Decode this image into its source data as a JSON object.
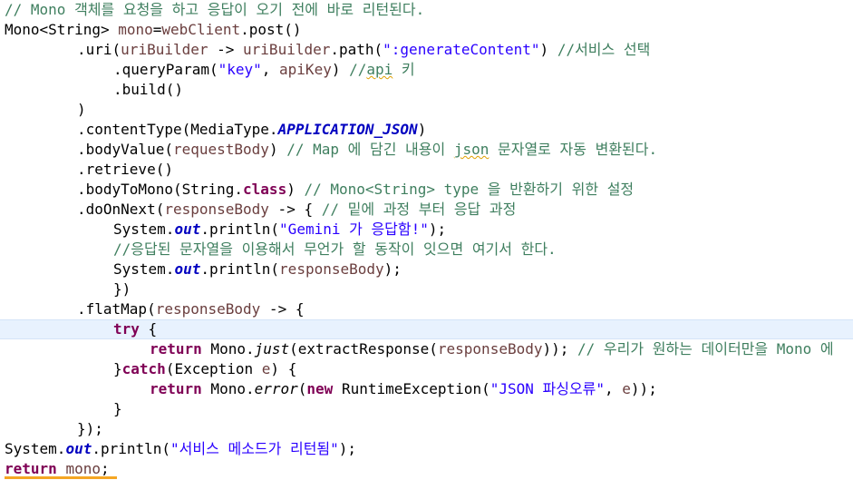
{
  "lines": [
    {
      "indent": 0,
      "tokens": [
        {
          "t": "cm",
          "v": "// Mono 객체를 요청을 하고 응답이 오기 전에 바로 리턴된다."
        }
      ]
    },
    {
      "indent": 0,
      "tokens": [
        {
          "t": "",
          "v": "Mono<String> "
        },
        {
          "t": "var",
          "v": "mono"
        },
        {
          "t": "",
          "v": "="
        },
        {
          "t": "var",
          "v": "webClient"
        },
        {
          "t": "",
          "v": ".post()"
        }
      ]
    },
    {
      "indent": 1,
      "tokens": [
        {
          "t": "",
          "v": ".uri("
        },
        {
          "t": "var",
          "v": "uriBuilder"
        },
        {
          "t": "",
          "v": " -> "
        },
        {
          "t": "var",
          "v": "uriBuilder"
        },
        {
          "t": "",
          "v": ".path("
        },
        {
          "t": "str",
          "v": "\":generateContent\""
        },
        {
          "t": "",
          "v": ") "
        },
        {
          "t": "cm",
          "v": "//서비스 선택"
        }
      ]
    },
    {
      "indent": 2,
      "tokens": [
        {
          "t": "",
          "v": ".queryParam("
        },
        {
          "t": "str",
          "v": "\"key\""
        },
        {
          "t": "",
          "v": ", "
        },
        {
          "t": "var",
          "v": "apiKey"
        },
        {
          "t": "",
          "v": ") "
        },
        {
          "t": "cm",
          "v": "//"
        },
        {
          "t": "cm squiggle",
          "v": "api"
        },
        {
          "t": "cm",
          "v": " 키"
        }
      ]
    },
    {
      "indent": 2,
      "tokens": [
        {
          "t": "",
          "v": ".build()"
        }
      ]
    },
    {
      "indent": 1,
      "tokens": [
        {
          "t": "",
          "v": ")"
        }
      ]
    },
    {
      "indent": 1,
      "tokens": [
        {
          "t": "",
          "v": ".contentType(MediaType."
        },
        {
          "t": "cst",
          "v": "APPLICATION_JSON"
        },
        {
          "t": "",
          "v": ")"
        }
      ]
    },
    {
      "indent": 1,
      "tokens": [
        {
          "t": "",
          "v": ".bodyValue("
        },
        {
          "t": "var",
          "v": "requestBody"
        },
        {
          "t": "",
          "v": ") "
        },
        {
          "t": "cm",
          "v": "// Map 에 담긴 내용이 "
        },
        {
          "t": "cm squiggle",
          "v": "json"
        },
        {
          "t": "cm",
          "v": " 문자열로 자동 변환된다."
        }
      ]
    },
    {
      "indent": 1,
      "tokens": [
        {
          "t": "",
          "v": ".retrieve()"
        }
      ]
    },
    {
      "indent": 1,
      "tokens": [
        {
          "t": "",
          "v": ".bodyToMono(String."
        },
        {
          "t": "kw",
          "v": "class"
        },
        {
          "t": "",
          "v": ") "
        },
        {
          "t": "cm",
          "v": "// Mono<String> type 을 반환하기 위한 설정"
        }
      ]
    },
    {
      "indent": 1,
      "tokens": [
        {
          "t": "",
          "v": ".doOnNext("
        },
        {
          "t": "var",
          "v": "responseBody"
        },
        {
          "t": "",
          "v": " -> { "
        },
        {
          "t": "cm",
          "v": "// 밑에 과정 부터 응답 과정"
        }
      ]
    },
    {
      "indent": 2,
      "tokens": [
        {
          "t": "",
          "v": "System."
        },
        {
          "t": "fld",
          "v": "out"
        },
        {
          "t": "",
          "v": ".println("
        },
        {
          "t": "str",
          "v": "\"Gemini 가 응답함!\""
        },
        {
          "t": "",
          "v": ");"
        }
      ]
    },
    {
      "indent": 2,
      "tokens": [
        {
          "t": "cm",
          "v": "//응답된 문자열을 이용해서 무언가 할 동작이 잇으면 여기서 한다."
        }
      ]
    },
    {
      "indent": 2,
      "tokens": [
        {
          "t": "",
          "v": "System."
        },
        {
          "t": "fld",
          "v": "out"
        },
        {
          "t": "",
          "v": ".println("
        },
        {
          "t": "var",
          "v": "responseBody"
        },
        {
          "t": "",
          "v": ");"
        }
      ]
    },
    {
      "indent": 2,
      "tokens": [
        {
          "t": "",
          "v": "})"
        }
      ]
    },
    {
      "indent": 1,
      "tokens": [
        {
          "t": "",
          "v": ".flatMap("
        },
        {
          "t": "var",
          "v": "responseBody"
        },
        {
          "t": "",
          "v": " -> {"
        }
      ]
    },
    {
      "indent": 2,
      "current": true,
      "tokens": [
        {
          "t": "kw",
          "v": "try"
        },
        {
          "t": "",
          "v": " {"
        }
      ]
    },
    {
      "indent": 3,
      "tokens": [
        {
          "t": "kw",
          "v": "return"
        },
        {
          "t": "",
          "v": " Mono."
        },
        {
          "t": "mth",
          "v": "just"
        },
        {
          "t": "",
          "v": "(extractResponse("
        },
        {
          "t": "var",
          "v": "responseBody"
        },
        {
          "t": "",
          "v": ")); "
        },
        {
          "t": "cm",
          "v": "// 우리가 원하는 데이터만을 Mono 에"
        }
      ]
    },
    {
      "indent": 2,
      "tokens": [
        {
          "t": "",
          "v": "}"
        },
        {
          "t": "kw",
          "v": "catch"
        },
        {
          "t": "",
          "v": "(Exception "
        },
        {
          "t": "var",
          "v": "e"
        },
        {
          "t": "",
          "v": ") {"
        }
      ]
    },
    {
      "indent": 3,
      "tokens": [
        {
          "t": "kw",
          "v": "return"
        },
        {
          "t": "",
          "v": " Mono."
        },
        {
          "t": "mth",
          "v": "error"
        },
        {
          "t": "",
          "v": "("
        },
        {
          "t": "kw",
          "v": "new"
        },
        {
          "t": "",
          "v": " RuntimeException("
        },
        {
          "t": "str",
          "v": "\"JSON 파싱오류\""
        },
        {
          "t": "",
          "v": ", "
        },
        {
          "t": "var",
          "v": "e"
        },
        {
          "t": "",
          "v": "));"
        }
      ]
    },
    {
      "indent": 2,
      "tokens": [
        {
          "t": "",
          "v": "}"
        }
      ]
    },
    {
      "indent": 1,
      "tokens": [
        {
          "t": "",
          "v": "});"
        }
      ]
    },
    {
      "indent": 0,
      "tokens": [
        {
          "t": "",
          "v": "System."
        },
        {
          "t": "fld",
          "v": "out"
        },
        {
          "t": "",
          "v": ".println("
        },
        {
          "t": "str",
          "v": "\"서비스 메소드가 리턴됨\""
        },
        {
          "t": "",
          "v": ");"
        }
      ]
    },
    {
      "indent": 0,
      "marked": true,
      "tokens": [
        {
          "t": "kw",
          "v": "return"
        },
        {
          "t": "",
          "v": " "
        },
        {
          "t": "var",
          "v": "mono"
        },
        {
          "t": "",
          "v": ";"
        }
      ]
    }
  ]
}
